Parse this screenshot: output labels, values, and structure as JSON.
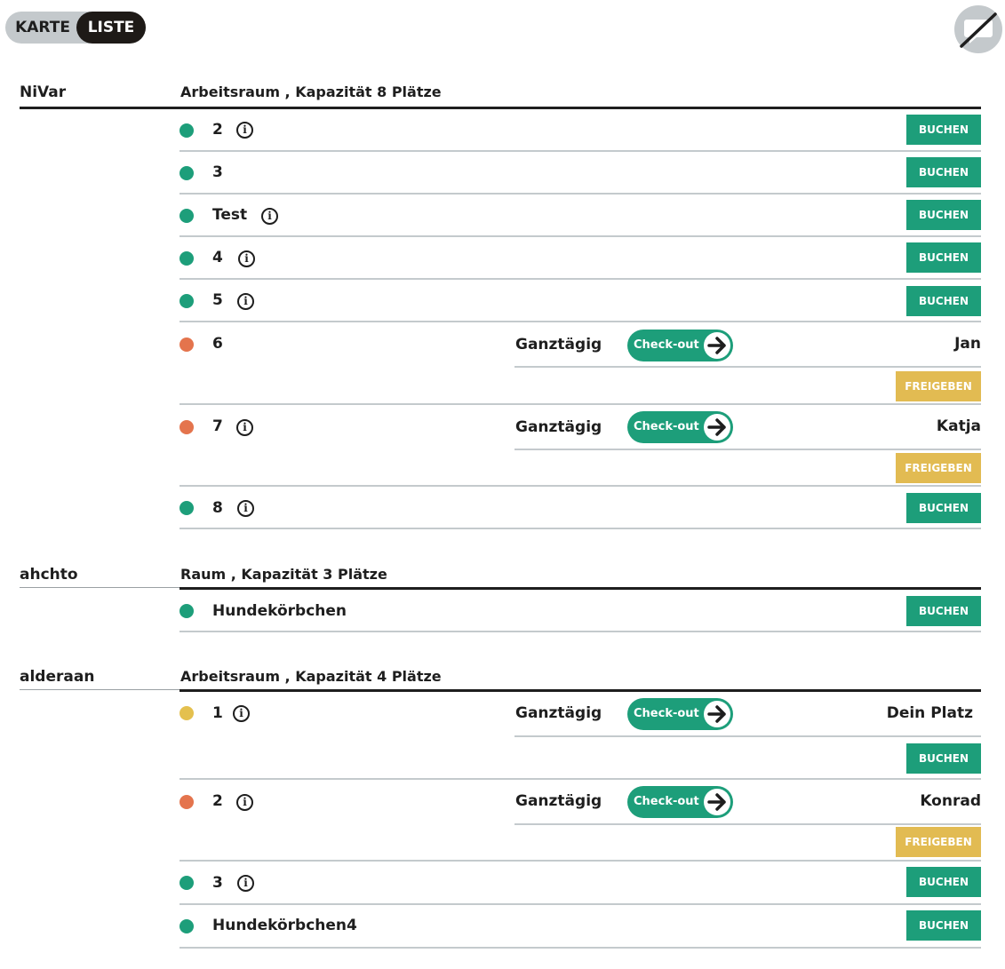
{
  "view_toggle": {
    "karte_label": "KARTE",
    "liste_label": "LISTE",
    "active": "LISTE"
  },
  "chat_button": {
    "icon": "chat-disabled-icon"
  },
  "colors": {
    "available": "#1d9e7a",
    "booked": "#e4744d",
    "own_booking": "#e4c04e",
    "book_button": "#1d9e7a",
    "release_button": "#e2bb52"
  },
  "sections": [
    {
      "location": "NiVar",
      "room": "Arbeitsraum , Kapazität 8 Plätze",
      "rows": [
        {
          "status": "available",
          "seat": "2",
          "info": "i",
          "action": "BUCHEN"
        },
        {
          "status": "available",
          "seat": "3",
          "action": "BUCHEN"
        },
        {
          "status": "available",
          "seat": "Test",
          "info": "i",
          "action": "BUCHEN"
        },
        {
          "status": "available",
          "seat": "4",
          "info": "i",
          "action": "BUCHEN"
        },
        {
          "status": "available",
          "seat": "5",
          "info": "i",
          "action": "BUCHEN"
        },
        {
          "status": "booked",
          "seat": "6",
          "duration": "Ganztägig",
          "checkout": "Check-out",
          "person": "Jan",
          "action": "FREIGEBEN"
        },
        {
          "status": "booked",
          "seat": "7",
          "info": "i",
          "duration": "Ganztägig",
          "checkout": "Check-out",
          "person": "Katja",
          "action": "FREIGEBEN"
        },
        {
          "status": "available",
          "seat": "8",
          "info": "i",
          "action": "BUCHEN"
        }
      ]
    },
    {
      "location": "ahchto",
      "room": "Raum , Kapazität 3 Plätze",
      "rows": [
        {
          "status": "available",
          "seat": "Hundekörbchen",
          "action": "BUCHEN"
        }
      ]
    },
    {
      "location": "alderaan",
      "room": "Arbeitsraum , Kapazität 4 Plätze",
      "rows": [
        {
          "status": "own_booking",
          "seat": "1",
          "info": "i",
          "duration": "Ganztägig",
          "checkout": "Check-out",
          "person": "Dein Platz",
          "action": "BUCHEN"
        },
        {
          "status": "booked",
          "seat": "2",
          "info": "i",
          "duration": "Ganztägig",
          "checkout": "Check-out",
          "person": "Konrad",
          "action": "FREIGEBEN"
        },
        {
          "status": "available",
          "seat": "3",
          "info": "i",
          "action": "BUCHEN"
        },
        {
          "status": "available",
          "seat": "Hundekörbchen4",
          "action": "BUCHEN"
        }
      ]
    }
  ]
}
